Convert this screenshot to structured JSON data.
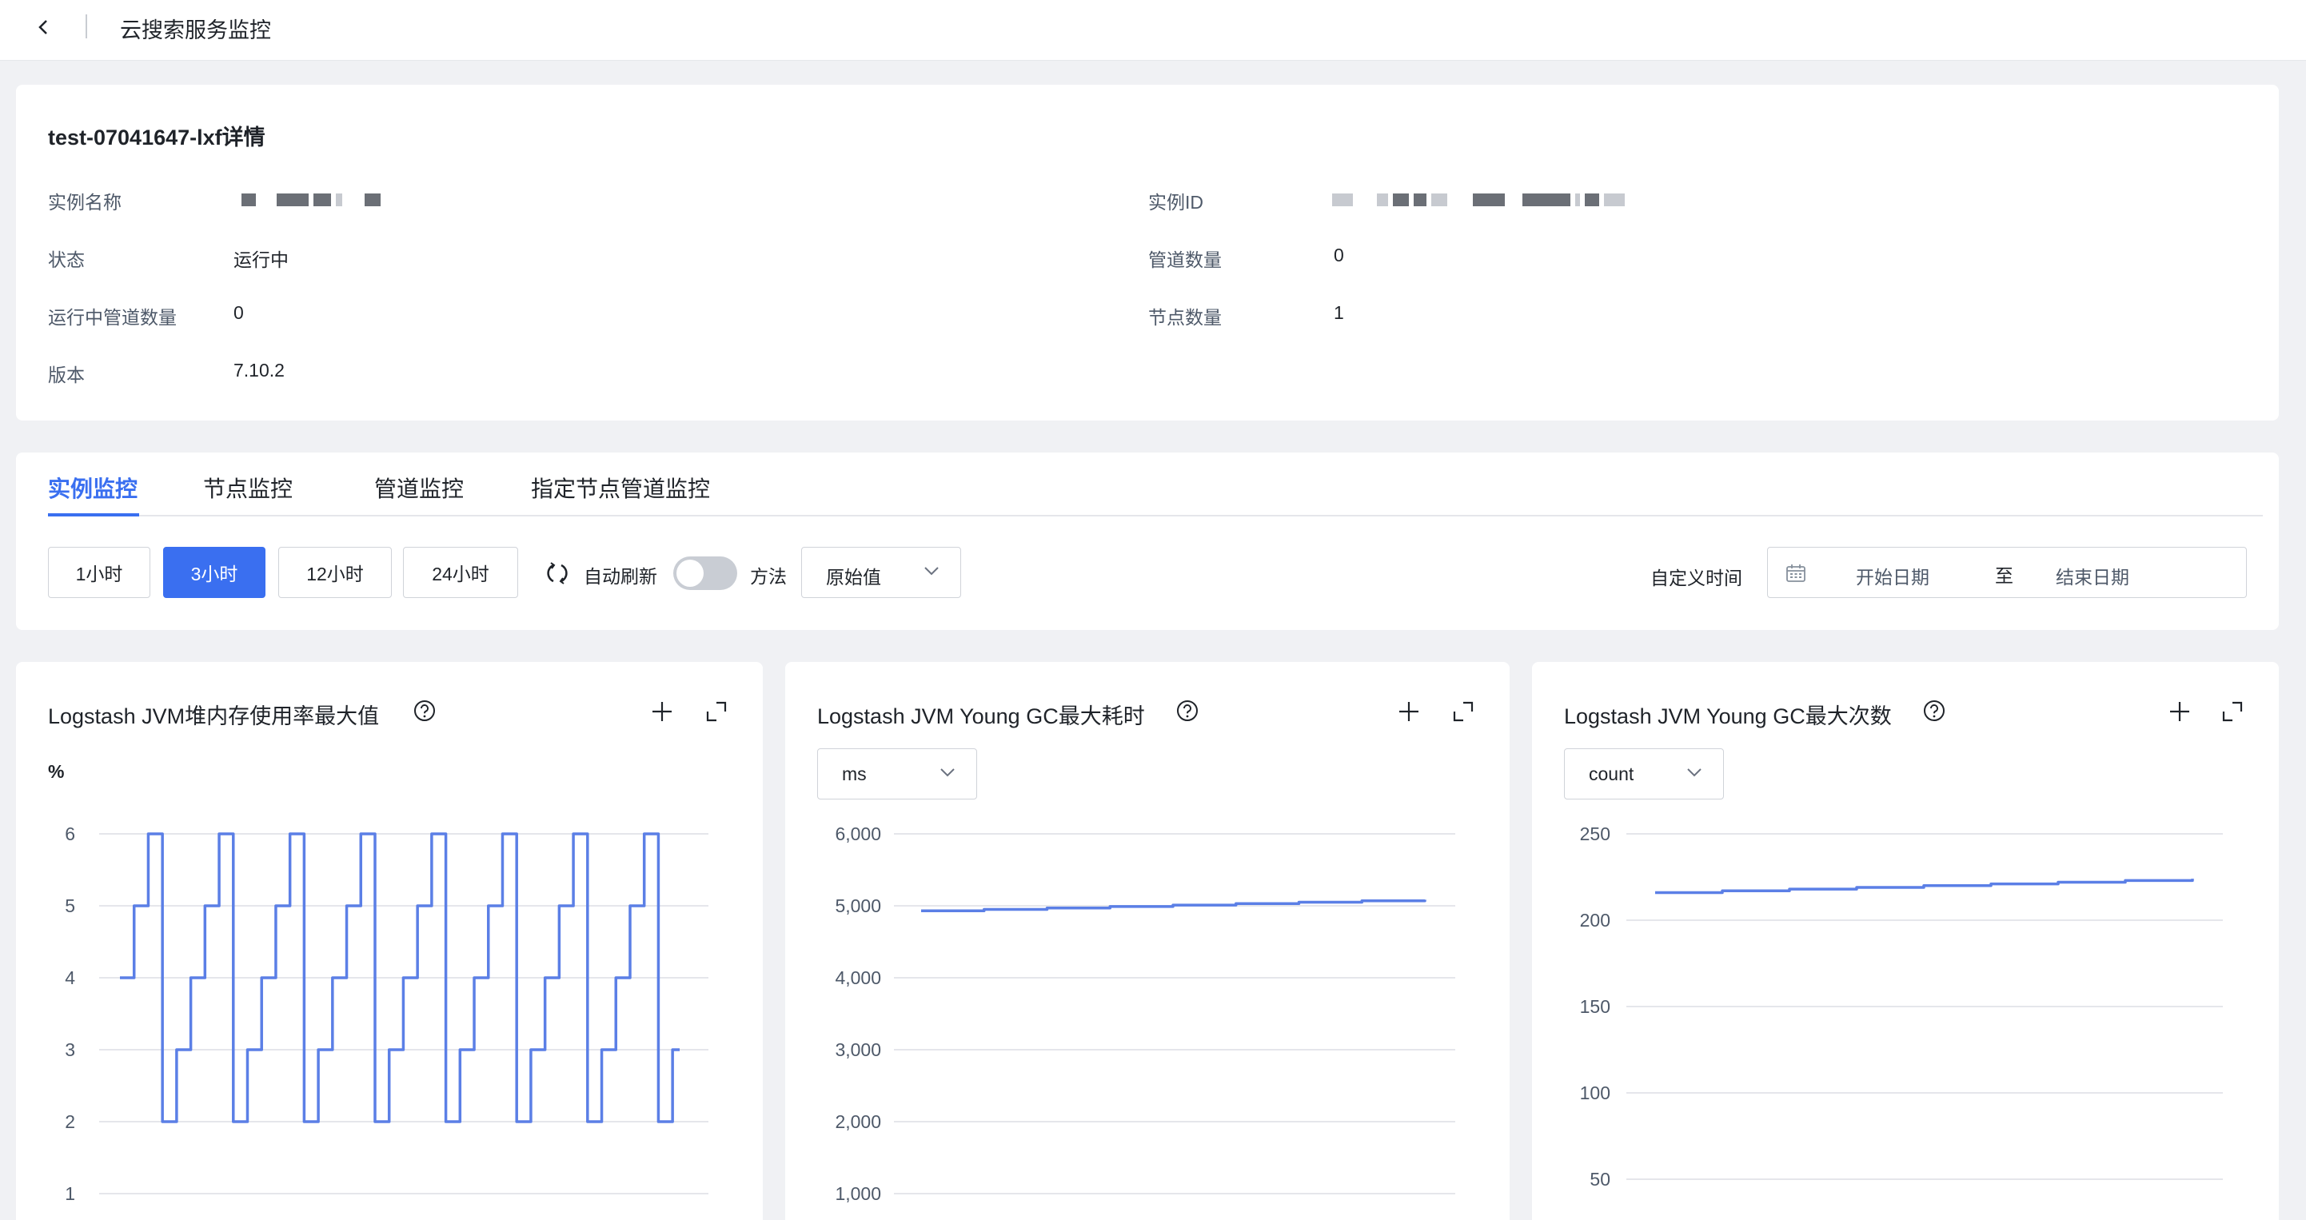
{
  "header": {
    "title": "云搜索服务监控"
  },
  "info": {
    "title": "test-07041647-lxf详情",
    "fields": {
      "instance_name_label": "实例名称",
      "instance_id_label": "实例ID",
      "status_label": "状态",
      "status_value": "运行中",
      "pipeline_count_label": "管道数量",
      "pipeline_count_value": "0",
      "running_pipeline_label": "运行中管道数量",
      "running_pipeline_value": "0",
      "node_count_label": "节点数量",
      "node_count_value": "1",
      "version_label": "版本",
      "version_value": "7.10.2"
    }
  },
  "tabs": [
    "实例监控",
    "节点监控",
    "管道监控",
    "指定节点管道监控"
  ],
  "controls": {
    "ranges": [
      "1小时",
      "3小时",
      "12小时",
      "24小时"
    ],
    "active_range": "3小时",
    "auto_refresh_label": "自动刷新",
    "auto_refresh_on": false,
    "method_label": "方法",
    "method_value": "原始值",
    "custom_time_label": "自定义时间",
    "start_placeholder": "开始日期",
    "range_separator": "至",
    "end_placeholder": "结束日期"
  },
  "colors": {
    "accent": "#3a6ff0",
    "line": "#5b7fe6",
    "grid": "#e5e6eb"
  },
  "charts": [
    {
      "title": "Logstash JVM堆内存使用率最大值",
      "unit": "%"
    },
    {
      "title": "Logstash JVM Young GC最大耗时",
      "unit": "ms"
    },
    {
      "title": "Logstash JVM Young GC最大次数",
      "unit": "count"
    }
  ],
  "chart_data": [
    {
      "type": "line",
      "title": "Logstash JVM堆内存使用率最大值",
      "ylabel": "%",
      "ylim": [
        1,
        6
      ],
      "yticks": [
        "1",
        "2",
        "3",
        "4",
        "5",
        "6"
      ],
      "grid": true,
      "step": true,
      "series": [
        {
          "values": [
            4,
            4,
            5,
            5,
            6,
            6,
            2,
            2,
            3,
            3,
            4,
            4,
            5,
            5,
            6,
            6,
            2,
            2,
            3,
            3,
            4,
            4,
            5,
            5,
            6,
            6,
            2,
            2,
            3,
            3,
            4,
            4,
            5,
            5,
            6,
            6,
            2,
            2,
            3,
            3,
            4,
            4,
            5,
            5,
            6,
            6,
            2,
            2,
            3,
            3,
            4,
            4,
            5,
            5,
            6,
            6,
            2,
            2,
            3,
            3,
            4,
            4,
            5,
            5,
            6,
            6,
            2,
            2,
            3,
            3,
            4,
            4,
            5,
            5,
            6,
            6,
            2,
            2,
            3,
            3
          ]
        }
      ]
    },
    {
      "type": "line",
      "title": "Logstash JVM Young GC最大耗时",
      "ylabel": "ms",
      "ylim": [
        1000,
        6000
      ],
      "yticks": [
        "1,000",
        "2,000",
        "3,000",
        "4,000",
        "5,000",
        "6,000"
      ],
      "grid": true,
      "step": true,
      "series": [
        {
          "values": [
            4930,
            4930,
            4950,
            4950,
            4970,
            4970,
            4990,
            4990,
            5010,
            5010,
            5030,
            5030,
            5050,
            5050,
            5070,
            5070,
            5085
          ]
        }
      ]
    },
    {
      "type": "line",
      "title": "Logstash JVM Young GC最大次数",
      "ylabel": "count",
      "ylim": [
        50,
        250
      ],
      "yticks": [
        "50",
        "100",
        "150",
        "200",
        "250"
      ],
      "grid": true,
      "step": true,
      "series": [
        {
          "values": [
            216,
            216,
            217,
            217,
            218,
            218,
            219,
            219,
            220,
            220,
            221,
            221,
            222,
            222,
            223,
            223,
            224
          ]
        }
      ]
    }
  ]
}
